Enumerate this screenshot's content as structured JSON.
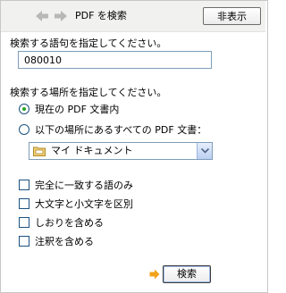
{
  "header": {
    "title": "PDF を検索",
    "hide_button": "非表示",
    "back_icon": "left-arrow-icon",
    "forward_icon": "right-arrow-icon"
  },
  "query": {
    "label": "検索する語句を指定してください。",
    "value": "080010"
  },
  "location": {
    "label": "検索する場所を指定してください。",
    "options": [
      {
        "label": "現在の PDF 文書内",
        "selected": true
      },
      {
        "label": "以下の場所にあるすべての PDF 文書：",
        "selected": false
      }
    ],
    "folder_select": "マイ ドキュメント"
  },
  "checkboxes": [
    {
      "label": "完全に一致する語のみ",
      "checked": false
    },
    {
      "label": "大文字と小文字を区別",
      "checked": false
    },
    {
      "label": "しおりを含める",
      "checked": false
    },
    {
      "label": "注釈を含める",
      "checked": false
    }
  ],
  "search_button": "検索",
  "colors": {
    "radio_selected": "#23a421",
    "arrow_orange": "#f0a21a",
    "input_border": "#7f9db9"
  }
}
